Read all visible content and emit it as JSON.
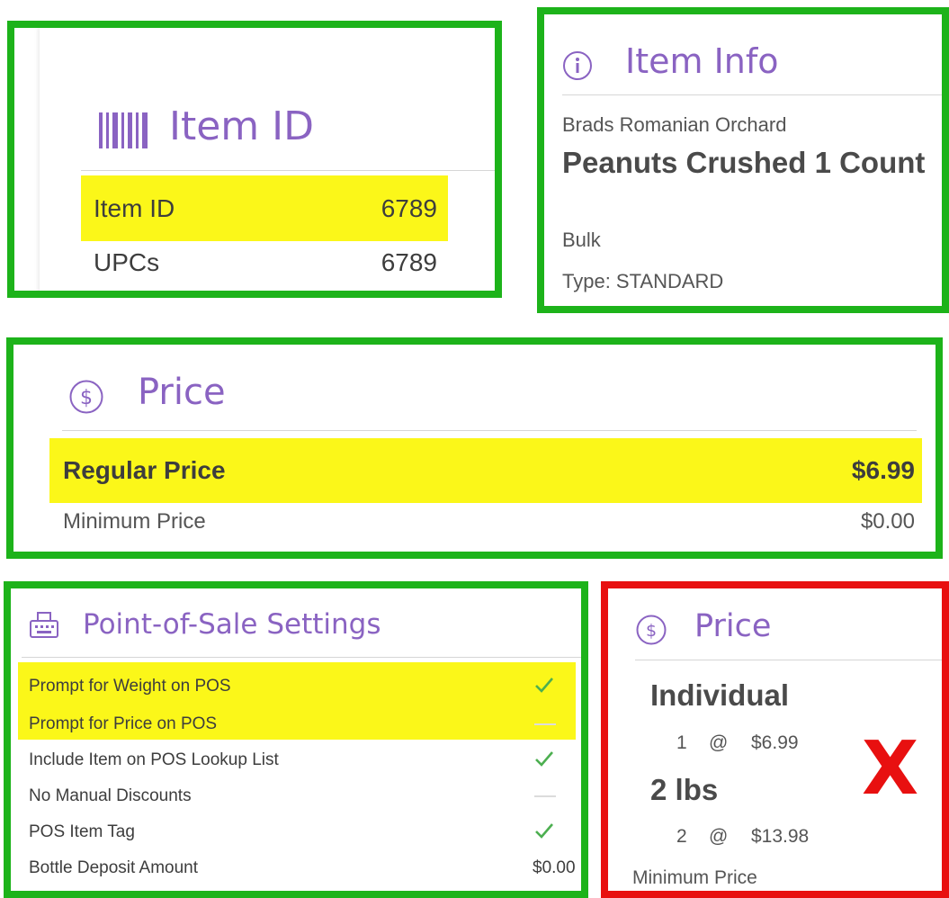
{
  "item_id_card": {
    "title": "Item ID",
    "rows": [
      {
        "label": "Item ID",
        "value": "6789"
      },
      {
        "label": "UPCs",
        "value": "6789"
      }
    ]
  },
  "item_info_card": {
    "title": "Item Info",
    "brand": "Brads Romanian Orchard",
    "name": "Peanuts Crushed 1 Count",
    "unit": "Bulk",
    "type": "Type: STANDARD"
  },
  "price_card": {
    "title": "Price",
    "regular_label": "Regular Price",
    "regular_value": "$6.99",
    "minimum_label": "Minimum Price",
    "minimum_value": "$0.00"
  },
  "pos_card": {
    "title": "Point-of-Sale Settings",
    "rows": [
      {
        "label": "Prompt for Weight on POS",
        "state": "check"
      },
      {
        "label": "Prompt for Price on POS",
        "state": "dash"
      },
      {
        "label": "Include Item on POS Lookup List",
        "state": "check"
      },
      {
        "label": "No Manual Discounts",
        "state": "dash"
      },
      {
        "label": "POS Item Tag",
        "state": "check"
      },
      {
        "label": "Bottle Deposit Amount",
        "value": "$0.00"
      }
    ]
  },
  "price_card_alt": {
    "title": "Price",
    "tiers": [
      {
        "name": "Individual",
        "qty": "1",
        "at": "@",
        "price": "$6.99"
      },
      {
        "name": "2 lbs",
        "qty": "2",
        "at": "@",
        "price": "$13.98"
      }
    ],
    "footer": "Minimum Price",
    "reject_mark": "X"
  },
  "colors": {
    "ok_border": "#1db31a",
    "bad_border": "#e81010",
    "highlight": "#fbf719",
    "accent": "#8a63c2",
    "check": "#4caf50"
  }
}
